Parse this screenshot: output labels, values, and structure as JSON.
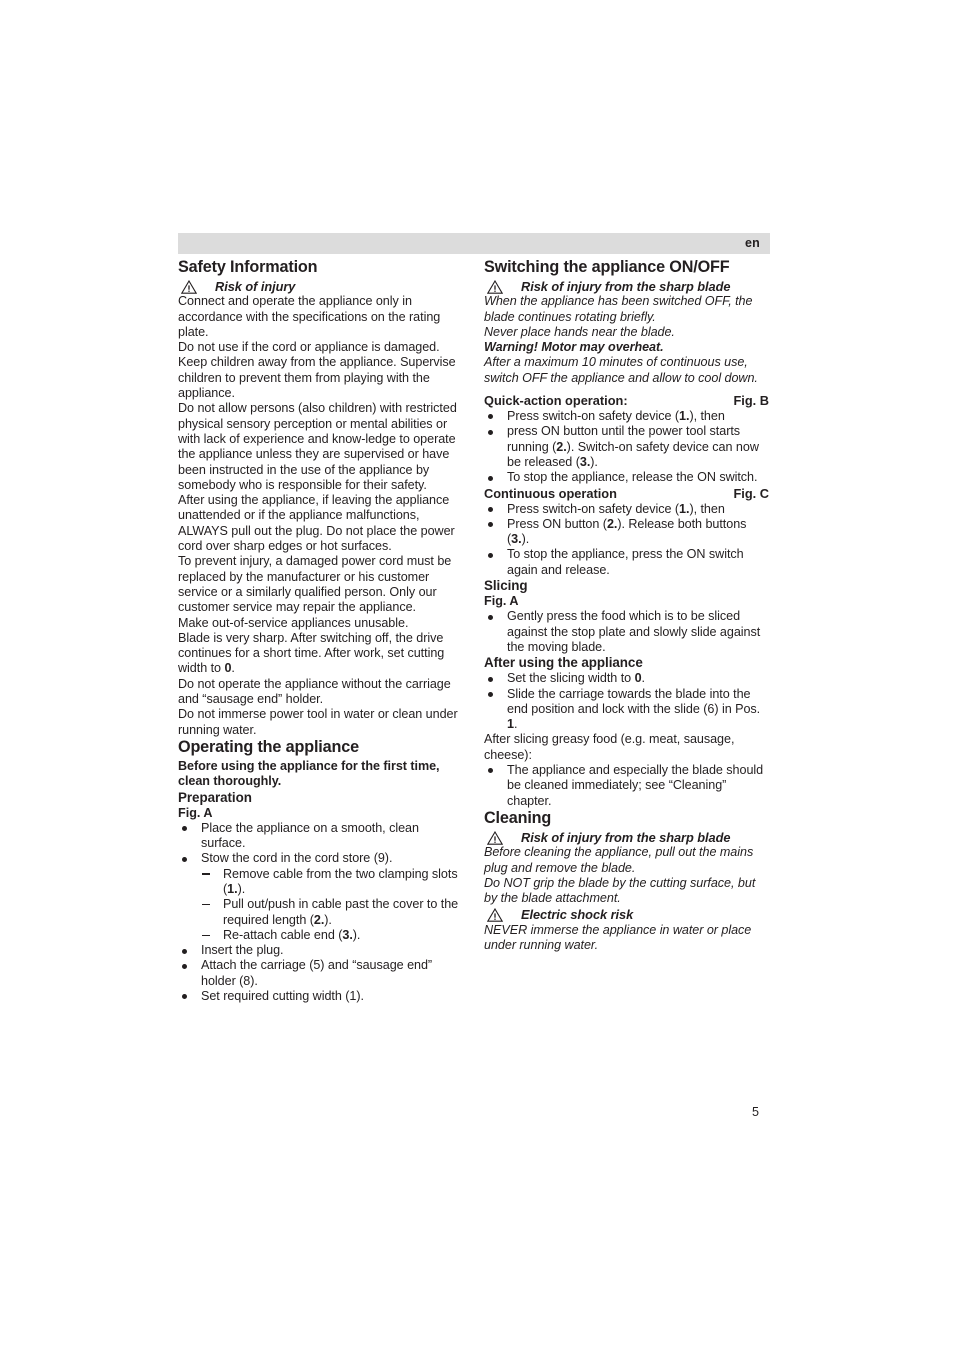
{
  "header": {
    "language": "en"
  },
  "page_number": "5",
  "left_column": {
    "safety": {
      "heading": "Safety Information",
      "warning_label": "Risk of injury",
      "paragraphs": [
        "Connect and operate the appliance only in accordance with the specifications on the rating plate.",
        "Do not use if the cord or appliance is damaged. Keep children away from the appliance. Supervise children to prevent them from playing with the appliance.",
        "Do not allow persons (also children) with restricted physical sensory perception or mental abilities or with lack of experience and know-ledge to operate the appliance unless they are supervised or have been instructed in the use of the appliance by somebody who is responsible for their safety.",
        "After using the appliance, if leaving the appliance unattended or if the appliance malfunctions, ALWAYS pull out the plug. Do not place the power cord over sharp edges or hot surfaces.",
        "To prevent injury, a damaged power cord must be replaced by the manufacturer or his customer service or a similarly qualified person. Only our customer service may repair the appliance.",
        "Make out-of-service appliances unusable."
      ],
      "blade_text_a": "Blade is very sharp. After switching off, the drive continues for a short time. After work, set cutting width to ",
      "blade_bold": "0",
      "blade_text_b": ".",
      "paragraphs_tail": [
        "Do not operate the appliance without the carriage and “sausage end” holder.",
        "Do not immerse power tool in water or clean under running water."
      ]
    },
    "operating": {
      "heading": "Operating the appliance",
      "intro_bold": "Before using the appliance for the first time, clean thoroughly.",
      "preparation_heading": "Preparation",
      "fig_label": "Fig. A",
      "bullets": [
        "Place the appliance on a smooth, clean surface.",
        "Stow the cord in the cord store (9)."
      ],
      "dashes": [
        {
          "a": "Remove cable from the two clamping slots (",
          "bold": "1.",
          "b": ")."
        },
        {
          "a": "Pull out/push in cable past the cover to the required length (",
          "bold": "2.",
          "b": ")."
        },
        {
          "a": "Re-attach cable end (",
          "bold": "3.",
          "b": ")."
        }
      ],
      "bullets_tail": [
        "Insert the plug.",
        "Attach the carriage (5) and “sausage end” holder (8).",
        "Set required cutting width (1)."
      ]
    }
  },
  "right_column": {
    "switching": {
      "heading": "Switching the appliance ON/OFF",
      "warning_label": "Risk of injury from the sharp blade",
      "italic_lines": [
        "When the appliance has been switched OFF, the blade continues rotating briefly.",
        "Never place hands near the blade."
      ],
      "overheat_bold": "Warning! Motor may overheat.",
      "overheat_italic": "After a maximum 10 minutes of continuous use, switch OFF the appliance and allow to cool down.",
      "quick": {
        "title": "Quick-action operation:",
        "fig": "Fig. B",
        "items": [
          {
            "a": "Press switch-on safety device (",
            "bold": "1.",
            "b": "), then"
          },
          {
            "a": "press ON button until the power tool starts running (",
            "bold": "2.",
            "b": "). Switch-on safety device can now be released (",
            "bold2": "3.",
            "c": ")."
          },
          {
            "a": "To stop the appliance, release the ON switch."
          }
        ]
      },
      "continuous": {
        "title": "Continuous operation",
        "fig": "Fig. C",
        "items": [
          {
            "a": "Press switch-on safety device (",
            "bold": "1.",
            "b": "), then"
          },
          {
            "a": "Press ON button (",
            "bold": "2.",
            "b": "). Release both buttons (",
            "bold2": "3.",
            "c": ")."
          },
          {
            "a": "To stop the appliance, press the ON switch again and release."
          }
        ]
      }
    },
    "slicing": {
      "heading": "Slicing",
      "fig_label": "Fig. A",
      "bullet": "Gently press the food which is to be sliced against the stop plate and slowly slide against the moving blade."
    },
    "after_use": {
      "heading": "After using the appliance",
      "item1_a": "Set the slicing width to ",
      "item1_bold": "0",
      "item1_b": ".",
      "item2_a": "Slide the carriage towards the blade into the end position and lock with the slide (6) in Pos. ",
      "item2_bold": "1",
      "item2_b": ".",
      "greasy_text": "After slicing greasy food (e.g. meat, sausage, cheese):",
      "greasy_bullet": "The appliance and especially the blade should be cleaned immediately; see “Cleaning” chapter."
    },
    "cleaning": {
      "heading": "Cleaning",
      "warning_label": "Risk of injury from the sharp blade",
      "italic_lines": [
        "Before cleaning the appliance, pull out the mains plug and remove the blade.",
        "Do NOT grip the blade by the cutting surface, but by the blade attachment."
      ],
      "shock_label": "Electric shock risk",
      "shock_italic": "NEVER immerse the appliance in water or place under running water."
    }
  },
  "icons": {
    "warning_triangle": "warning-triangle-icon",
    "bullet": "bullet-dot-icon",
    "dash": "dash-icon"
  },
  "colors": {
    "header_band": "#dcdcdc",
    "text": "#231f20",
    "page_background": "#ffffff"
  }
}
